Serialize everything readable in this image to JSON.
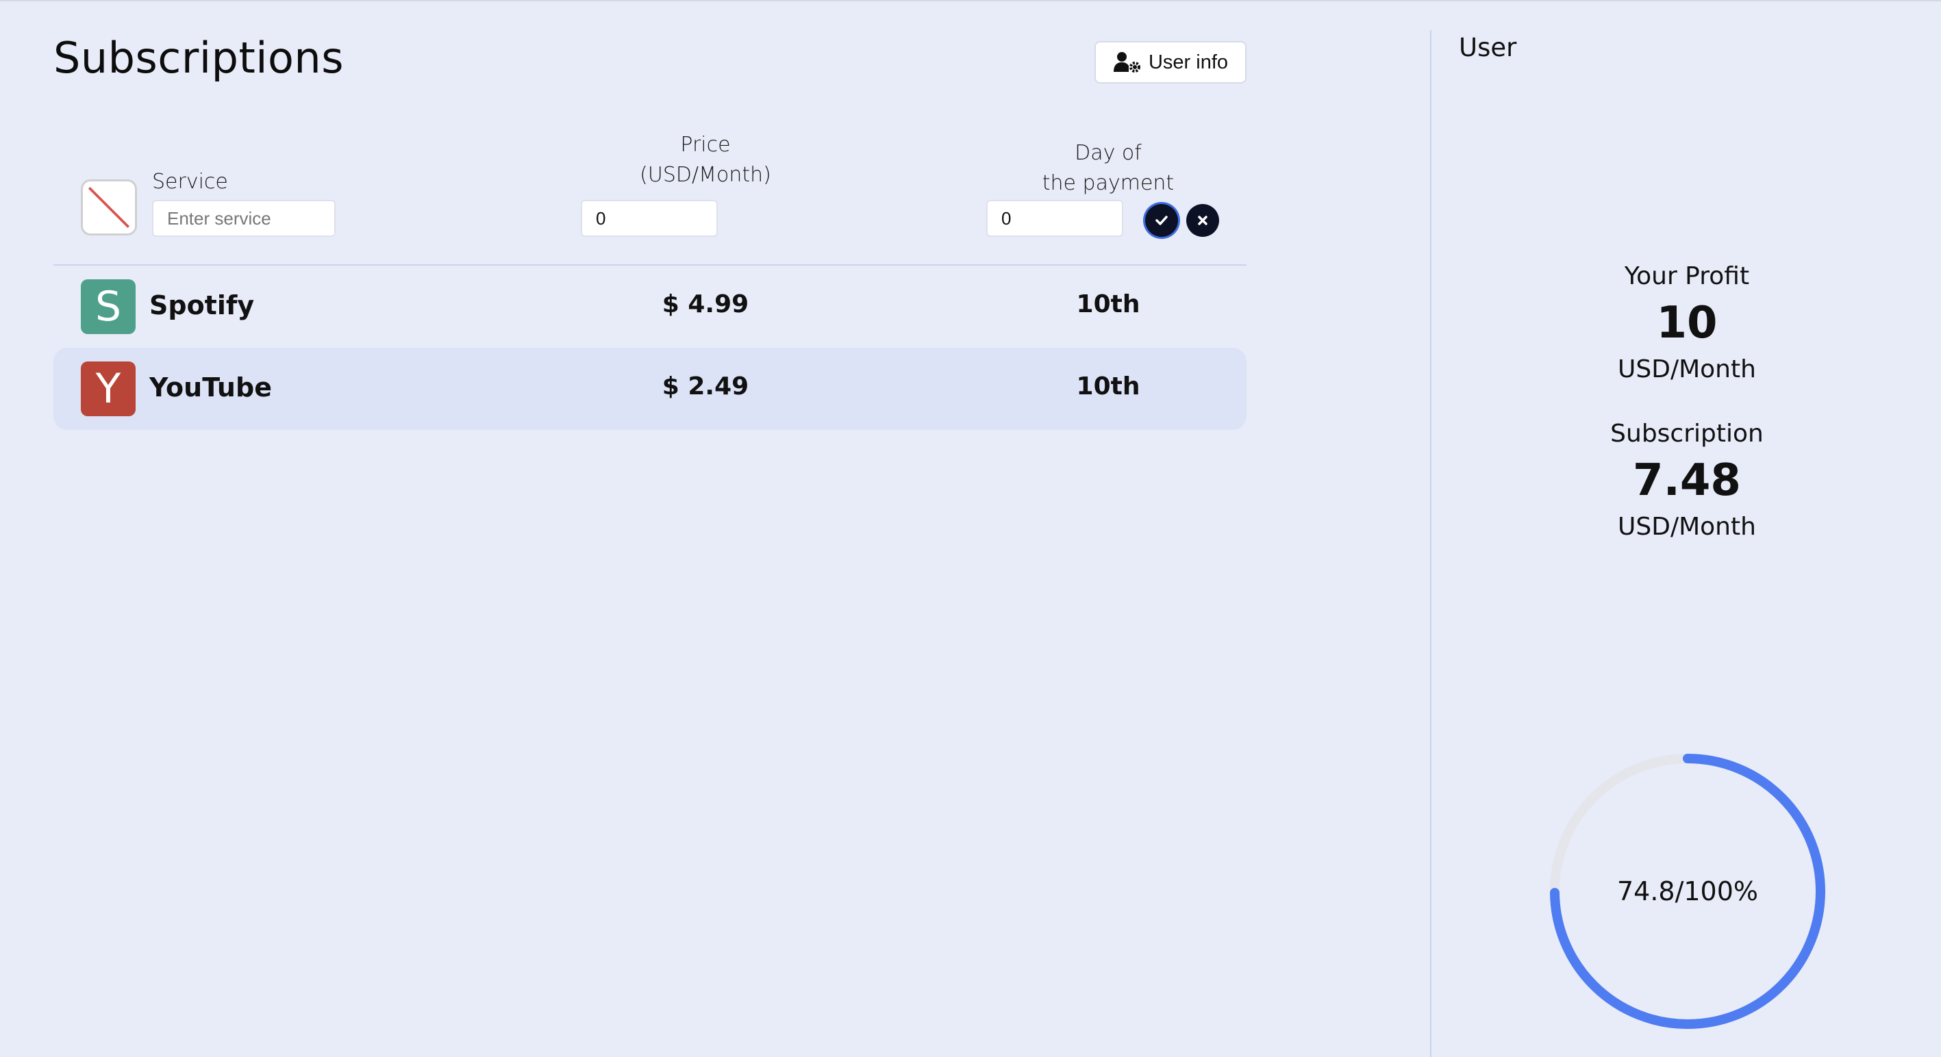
{
  "header": {
    "title": "Subscriptions",
    "user_info_label": "User info",
    "user_info_icon": "user-gear-icon"
  },
  "form": {
    "service_label": "Service",
    "service_placeholder": "Enter service",
    "price_label_line1": "Price",
    "price_label_line2": "(USD/Month)",
    "price_value": "0",
    "day_label_line1": "Day of",
    "day_label_line2": "the payment",
    "day_value": "0",
    "logo_icon": "no-image-icon",
    "confirm_icon": "check-icon",
    "cancel_icon": "close-icon"
  },
  "subscriptions": [
    {
      "initial": "S",
      "name": "Spotify",
      "price": "$ 4.99",
      "day": "10th",
      "color": "#4fa08b"
    },
    {
      "initial": "Y",
      "name": "YouTube",
      "price": "$ 2.49",
      "day": "10th",
      "color": "#b84537"
    }
  ],
  "sidebar": {
    "title": "User",
    "profit": {
      "label": "Your Profit",
      "value": "10",
      "unit": "USD/Month"
    },
    "subscription": {
      "label": "Subscription",
      "value": "7.48",
      "unit": "USD/Month"
    },
    "progress": {
      "text": "74.8/100%",
      "percent": 74.8,
      "color": "#4f7cf0",
      "track_color": "#e4e6ec"
    }
  }
}
